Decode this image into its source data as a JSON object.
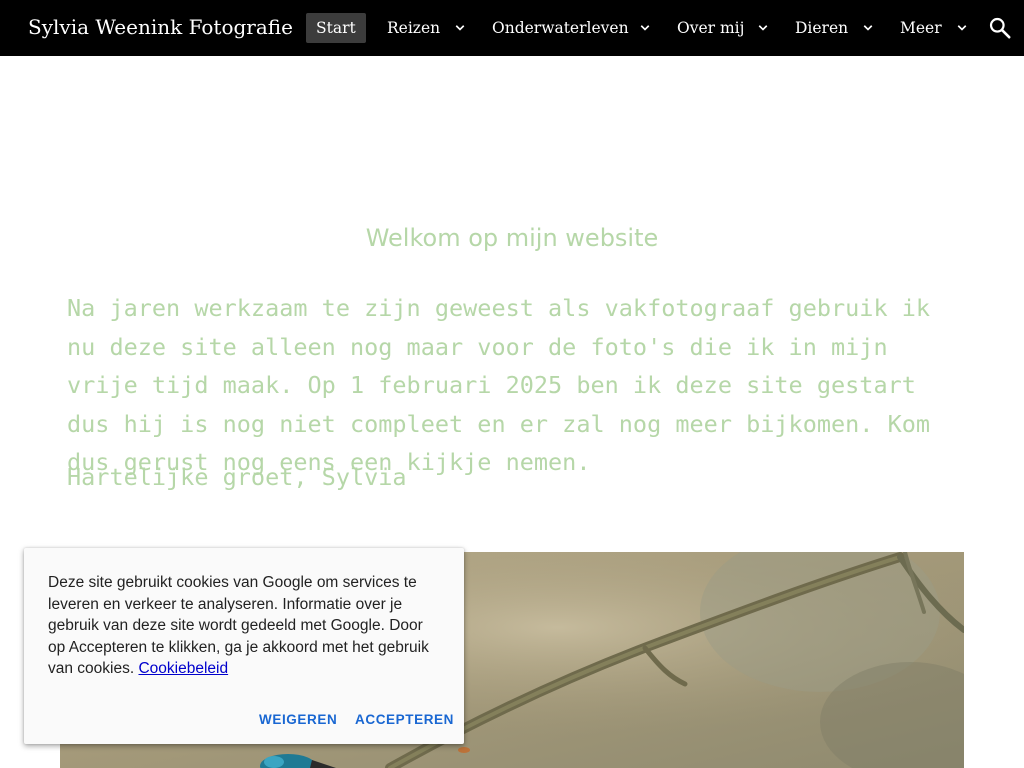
{
  "header": {
    "site_title": "Sylvia Weenink Fotografie",
    "nav": [
      {
        "label": "Start",
        "active": true
      },
      {
        "label": "Reizen",
        "has_dropdown": true
      },
      {
        "label": "Onderwaterleven",
        "has_dropdown": true
      },
      {
        "label": "Over mij",
        "has_dropdown": true
      },
      {
        "label": "Dieren",
        "has_dropdown": true
      },
      {
        "label": "Meer",
        "has_dropdown": true
      }
    ],
    "search_icon": "search-icon"
  },
  "main": {
    "heading": "Welkom op mijn website",
    "intro": "Na jaren werkzaam te zijn geweest als vakfotograaf gebruik ik nu deze site alleen nog maar voor de foto's die ik in mijn vrije tijd maak. Op 1 februari 2025 ben ik deze site gestart dus hij is nog niet compleet en er zal nog meer bijkomen. Kom dus gerust nog eens een kijkje nemen.",
    "greeting": "Hartelijke groet, Sylvia"
  },
  "cookie_banner": {
    "text": "Deze site gebruikt cookies van Google om services te leveren en verkeer te analyseren. Informatie over je gebruik van deze site wordt gedeeld met Google. Door op Accepteren te klikken, ga je akkoord met het gebruik van cookies.",
    "policy_link": "Cookiebeleid",
    "decline_label": "WEIGEREN",
    "accept_label": "ACCEPTEREN"
  },
  "colors": {
    "header_bg": "#000000",
    "text_accent": "#b6d7a8",
    "button_blue": "#1967d2",
    "link_blue": "#0000cc"
  }
}
